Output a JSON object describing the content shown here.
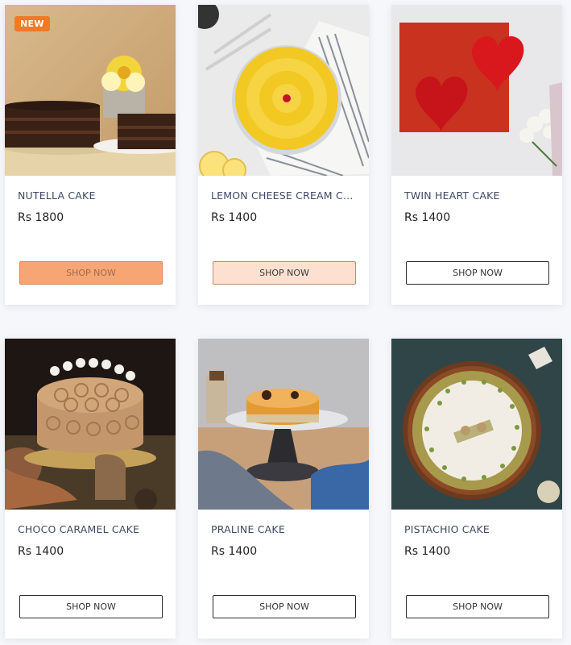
{
  "products": [
    {
      "name": "NUTELLA CAKE",
      "price": "Rs 1800",
      "button": "SHOP NOW",
      "badge": "NEW"
    },
    {
      "name": "LEMON CHEESE CREAM CA...",
      "price": "Rs 1400",
      "button": "SHOP NOW"
    },
    {
      "name": "TWIN HEART CAKE",
      "price": "Rs 1400",
      "button": "SHOP NOW"
    },
    {
      "name": "CHOCO CARAMEL CAKE",
      "price": "Rs 1400",
      "button": "SHOP NOW"
    },
    {
      "name": "PRALINE CAKE",
      "price": "Rs 1400",
      "button": "SHOP NOW"
    },
    {
      "name": "PISTACHIO CAKE",
      "price": "Rs 1400",
      "button": "SHOP NOW"
    }
  ],
  "colors": {
    "badge": "#f07a26",
    "title_text": "#3d4a63",
    "button_hover_strong": "#f7a574",
    "button_hover_light": "#fde0d0"
  }
}
